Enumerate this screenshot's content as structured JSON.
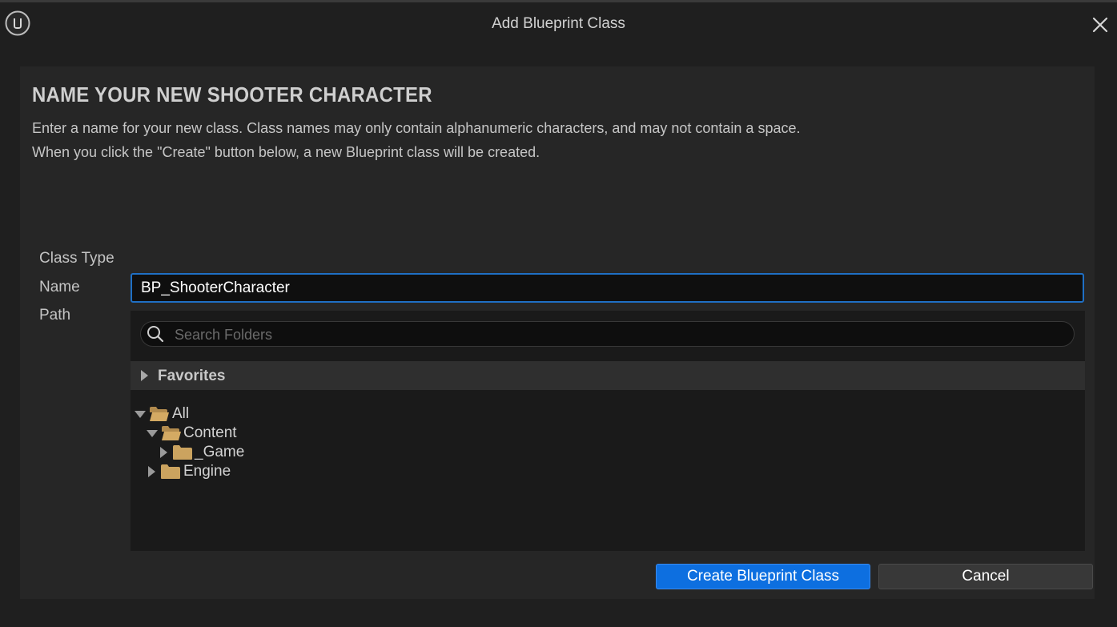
{
  "window": {
    "title": "Add Blueprint Class"
  },
  "dialog": {
    "heading": "NAME YOUR NEW SHOOTER CHARACTER",
    "description_line1": "Enter a name for your new class. Class names may only contain alphanumeric characters, and may not contain a space.",
    "description_line2": "When you click the \"Create\" button below, a new Blueprint class will be created."
  },
  "form": {
    "class_type_label": "Class Type",
    "name_label": "Name",
    "name_value": "BP_ShooterCharacter",
    "path_label": "Path"
  },
  "path_browser": {
    "search_placeholder": "Search Folders",
    "favorites_label": "Favorites",
    "tree": [
      {
        "label": "All",
        "expanded": true,
        "depth": 0
      },
      {
        "label": "Content",
        "expanded": true,
        "depth": 1
      },
      {
        "label": "_Game",
        "expanded": false,
        "depth": 2
      },
      {
        "label": "Engine",
        "expanded": false,
        "depth": 1
      }
    ]
  },
  "buttons": {
    "create_label": "Create Blueprint Class",
    "cancel_label": "Cancel"
  },
  "colors": {
    "accent": "#0d6fe0",
    "focus_border": "#1f6fc4",
    "folder": "#c9a15e",
    "background": "#1f1f1f"
  },
  "icons": {
    "logo": "unreal-engine-logo",
    "close": "close-icon",
    "search": "search-icon",
    "folder": "folder-icon"
  }
}
